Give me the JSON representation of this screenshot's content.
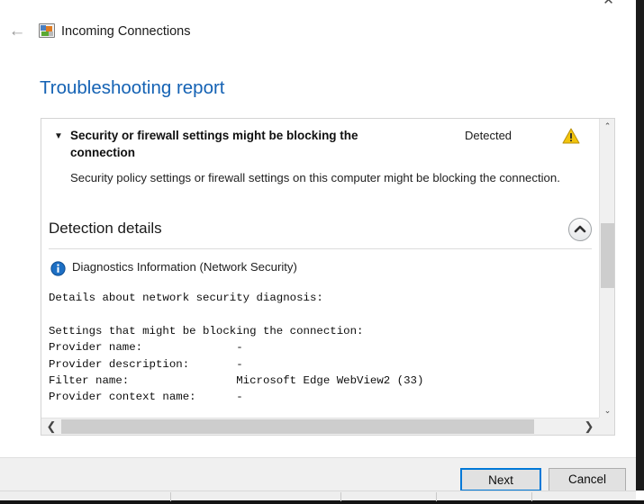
{
  "window": {
    "close_label": "✕",
    "nav": {
      "back_label": "←",
      "icon_name": "network-connections-icon",
      "title": "Incoming Connections"
    },
    "page_title": "Troubleshooting report"
  },
  "report": {
    "issue": {
      "toggle_glyph": "▼",
      "title": "Security or firewall settings might be blocking the connection",
      "status": "Detected",
      "status_icon": "warning-triangle-icon",
      "description": "Security policy settings or firewall settings on this computer might be blocking the connection."
    },
    "detection_details": {
      "heading": "Detection details",
      "collapse_icon": "chevron-up-icon",
      "diagnostics": {
        "icon": "info-circle-icon",
        "label": "Diagnostics Information (Network Security)"
      },
      "details_text": "Details about network security diagnosis:\n\nSettings that might be blocking the connection:\nProvider name:              -\nProvider description:       -\nFilter name:                Microsoft Edge WebView2 (33)\nProvider context name:      -"
    },
    "scrollbars": {
      "v_up": "⌃",
      "v_down": "⌄",
      "h_left": "❮",
      "h_right": "❯"
    }
  },
  "footer": {
    "next_label": "Next",
    "cancel_label": "Cancel"
  },
  "colors": {
    "accent_blue": "#1462b4",
    "focus_blue": "#0078d7",
    "warning_yellow": "#f5c518",
    "info_blue": "#1d6fc4"
  }
}
